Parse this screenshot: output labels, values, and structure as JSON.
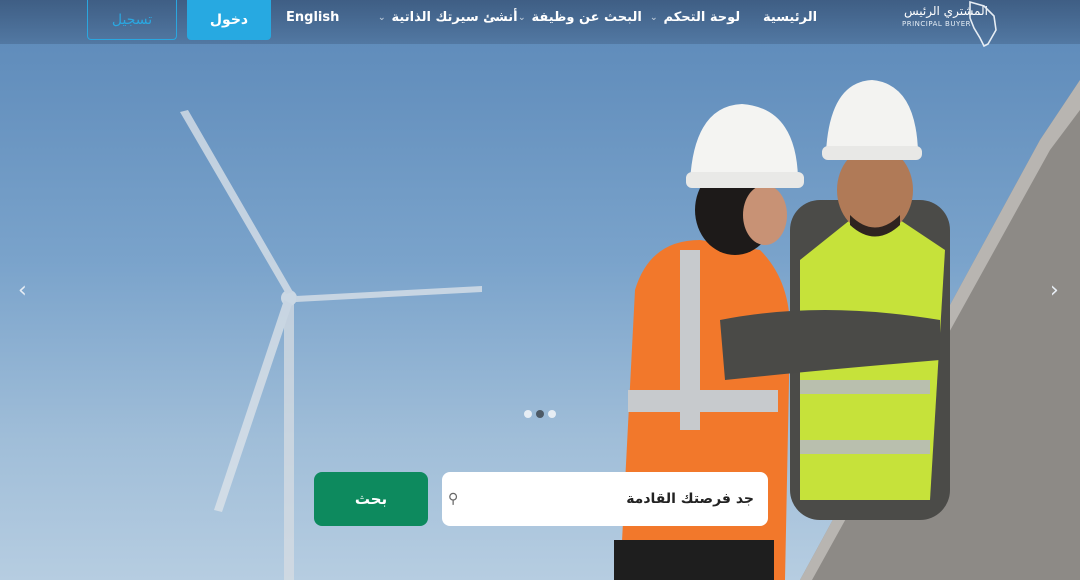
{
  "header": {
    "logo": {
      "text_ar": "المشتري الرئيس",
      "text_en": "PRINCIPAL BUYER"
    },
    "menu": [
      {
        "label": "الرئيسية",
        "has_dropdown": false
      },
      {
        "label": "لوحة التحكم",
        "has_dropdown": true
      },
      {
        "label": "البحث عن وظيفة",
        "has_dropdown": true
      },
      {
        "label": "أنشئ سيرتك الذاتية",
        "has_dropdown": true
      }
    ],
    "language_label": "English",
    "login_label": "دخول",
    "register_label": "تسجيل"
  },
  "carousel": {
    "prev_icon": "chevron-left-icon",
    "next_icon": "chevron-right-icon",
    "slide_count": 3,
    "active_slide": 2
  },
  "search": {
    "placeholder": "جد فرصتك القادمة",
    "button_label": "بحث"
  },
  "colors": {
    "login_bg": "#27a9e1",
    "register_border": "#2aa7e0",
    "search_button": "#0d8a5e"
  }
}
